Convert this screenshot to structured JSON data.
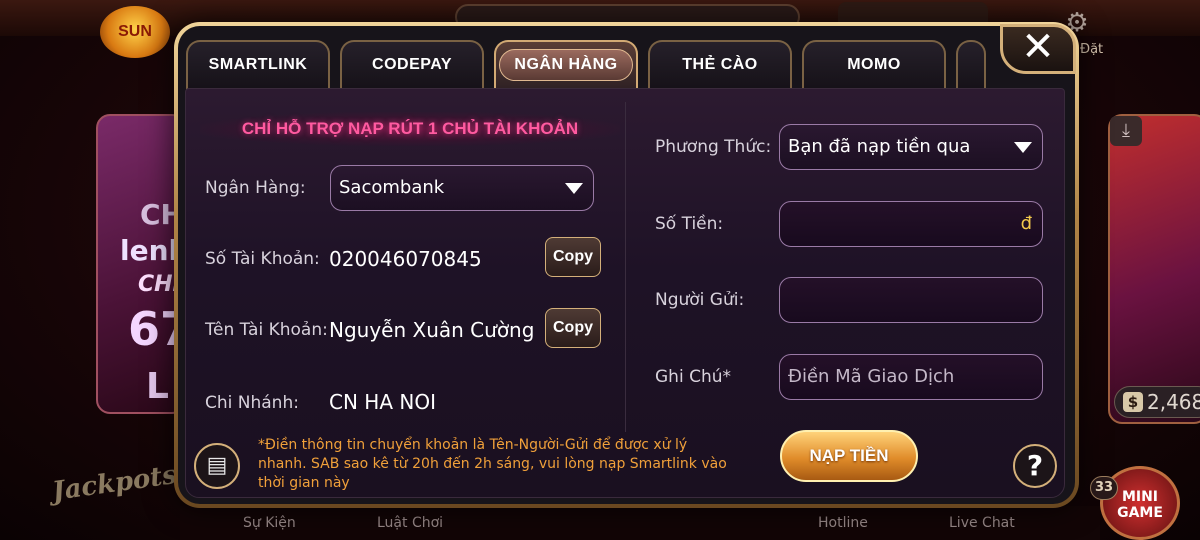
{
  "background": {
    "logo_text": "SUN",
    "settings_label": "Đặt",
    "left_card_lines": [
      "CH",
      "lenh",
      "CHI",
      "67",
      "L"
    ],
    "coin_amount": "2,468",
    "jackpot_label": "Jackpots",
    "mini_game_label": "MINI GAME",
    "mini_game_badge": "33",
    "bottom_nav": [
      "Sự Kiện",
      "Luật Chơi",
      "Hotline",
      "Live Chat"
    ]
  },
  "tabs": [
    {
      "label": "SMARTLINK",
      "active": false
    },
    {
      "label": "CODEPAY",
      "active": false
    },
    {
      "label": "NGÂN HÀNG",
      "active": true
    },
    {
      "label": "THẺ CÀO",
      "active": false
    },
    {
      "label": "MOMO",
      "active": false
    }
  ],
  "close_label": "✕",
  "bank_panel": {
    "notice_title": "CHỈ HỖ TRỢ NẠP RÚT 1 CHỦ TÀI KHOẢN",
    "bank_label": "Ngân Hàng:",
    "bank_value": "Sacombank",
    "account_number_label": "Số Tài Khoản:",
    "account_number_value": "020046070845",
    "account_name_label": "Tên Tài Khoản:",
    "account_name_value": "Nguyễn Xuân Cường",
    "branch_label": "Chi Nhánh:",
    "branch_value": "CN HA NOI",
    "copy_label": "Copy"
  },
  "form": {
    "method_label": "Phương Thức:",
    "method_value": "Bạn đã nạp tiền qua",
    "amount_label": "Số Tiền:",
    "amount_currency": "đ",
    "sender_label": "Người Gửi:",
    "note_label": "Ghi Chú*",
    "note_placeholder": "Điền Mã Giao Dịch",
    "submit_label": "NẠP TIỀN"
  },
  "footer_note": "*Điền thông tin chuyển khoản là Tên-Người-Gửi để được xử lý nhanh. SAB sao kê từ 20h đến 2h sáng, vui lòng nạp Smartlink vào thời gian này",
  "help_label": "?",
  "colors": {
    "gold_border": "#d4b07a",
    "notice_pink": "#ff5aa0",
    "note_orange": "#f0a03a",
    "currency_gold": "#f2c94c"
  }
}
